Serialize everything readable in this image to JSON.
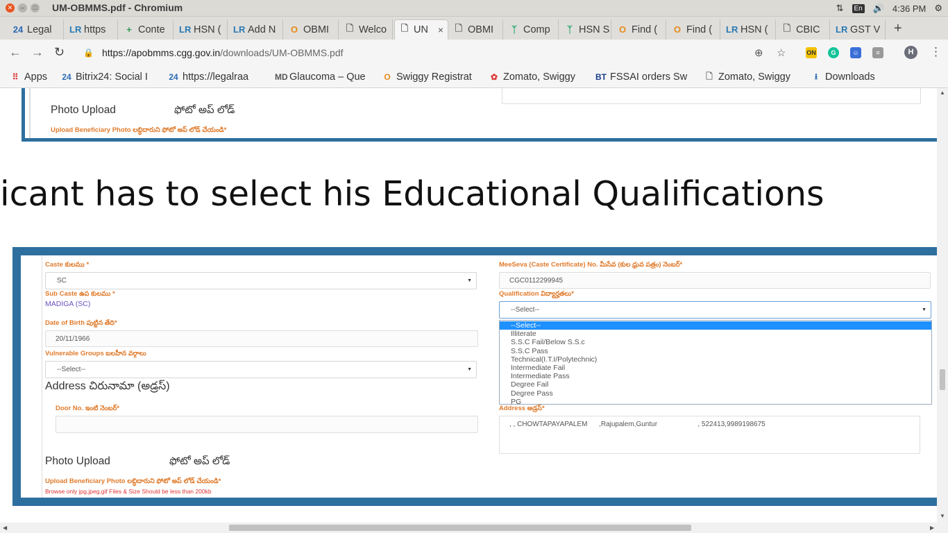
{
  "window": {
    "title": "UM-OBMMS.pdf - Chromium",
    "time": "4:36 PM",
    "keyboard_indicator": "En",
    "close_glyph": "✕",
    "min_glyph": "–",
    "max_glyph": "□"
  },
  "tabs": [
    {
      "icon_text": "24",
      "label": "Legal",
      "icon_color": "#2a6ab3"
    },
    {
      "icon_text": "LR",
      "label": "https",
      "icon_color": "#2a7ab3"
    },
    {
      "icon_text": "+",
      "label": "Conte",
      "icon_color": "#2e9e50"
    },
    {
      "icon_text": "LR",
      "label": "HSN (",
      "icon_color": "#2a7ab3"
    },
    {
      "icon_text": "LR",
      "label": "Add N",
      "icon_color": "#2a7ab3"
    },
    {
      "icon_text": "O",
      "label": "OBMI",
      "icon_color": "#e88a1a"
    },
    {
      "icon_text": "🗋",
      "label": "Welco",
      "icon_color": "#666"
    },
    {
      "icon_text": "🗋",
      "label": "UN",
      "icon_color": "#666"
    },
    {
      "icon_text": "🗋",
      "label": "OBMI",
      "icon_color": "#666"
    },
    {
      "icon_text": "ᛉ",
      "label": "Comp",
      "icon_color": "#2aa86a"
    },
    {
      "icon_text": "ᛉ",
      "label": "HSN S",
      "icon_color": "#2aa86a"
    },
    {
      "icon_text": "O",
      "label": "Find (",
      "icon_color": "#e88a1a"
    },
    {
      "icon_text": "O",
      "label": "Find (",
      "icon_color": "#e88a1a"
    },
    {
      "icon_text": "LR",
      "label": "HSN (",
      "icon_color": "#2a7ab3"
    },
    {
      "icon_text": "🗋",
      "label": "CBIC",
      "icon_color": "#666"
    },
    {
      "icon_text": "LR",
      "label": "GST V",
      "icon_color": "#2a7ab3"
    }
  ],
  "new_tab_label": "+",
  "toolbar": {
    "back": "←",
    "forward": "→",
    "reload": "↻",
    "url_host": "https://apobmms.cgg.gov.in",
    "url_path": "/downloads/UM-OBMMS.pdf",
    "profile_initial": "H",
    "menu": "⋮"
  },
  "bookmarks": [
    {
      "icon_text": "⠿",
      "label": "Apps",
      "icon_color": "#d33"
    },
    {
      "icon_text": "24",
      "label": "Bitrix24: Social I",
      "icon_color": "#2a6ab3"
    },
    {
      "icon_text": "24",
      "label": "https://legalraa",
      "icon_color": "#2a6ab3"
    },
    {
      "icon_text": "MD",
      "label": "Glaucoma – Que",
      "icon_color": "#555"
    },
    {
      "icon_text": "O",
      "label": "Swiggy Registrat",
      "icon_color": "#e88a1a"
    },
    {
      "icon_text": "✿",
      "label": "Zomato, Swiggy",
      "icon_color": "#d33"
    },
    {
      "icon_text": "BT",
      "label": "FSSAI orders Sw",
      "icon_color": "#1a3c8a"
    },
    {
      "icon_text": "🗋",
      "label": "Zomato, Swiggy",
      "icon_color": "#666"
    },
    {
      "icon_text": "⭳",
      "label": "Downloads",
      "icon_color": "#2a6ab3"
    }
  ],
  "top_panel": {
    "photo_upload": "Photo Upload",
    "photo_upload_telugu": "ఫోటో అప్ లోడ్",
    "upload_note": "Upload Beneficiary Photo లబ్ధిదారుని ఫోటో అప్ లోడ్ చేయండి*"
  },
  "heading": "icant has to select his Educational Qualifications",
  "form": {
    "caste_label": "Caste కులము *",
    "caste_value": "SC",
    "subcaste_label": "Sub Caste ఉప కులము *",
    "subcaste_value": "MADIGA (SC)",
    "dob_label": "Date of Birth పుట్టిన తేది*",
    "dob_value": "20/11/1966",
    "vulnerable_label": "Vulnerable Groups బలహీన వర్గాలు",
    "vulnerable_value": "--Select--",
    "address_heading": "Address చిరునామా (అడ్రస్)",
    "door_label": "Door No. ఇంటి నెంబర్*",
    "meeseva_label": "MeeSeva (Caste Certificate) No. మీసేవ (కుల ధ్రువ పత్రం) నెంబర్*",
    "meeseva_value": "CGC0112299945",
    "qualification_label": "Qualification విద్యార్హతలు*",
    "qualification_value": "--Select--",
    "qualification_options": [
      "--Select--",
      "Illiterate",
      "S.S.C Fail/Below S.S.c",
      "S.S.C Pass",
      "Technical(I.T.I/Polytechnic)",
      "Intermediate Fail",
      "Intermediate Pass",
      "Degree Fail",
      "Degree Pass",
      "PG"
    ],
    "address_label": "Address అడ్రస్*",
    "address_value": ", , CHOWTAPAYAPALEM      ,Rajupalem,Guntur                     , 522413,9989198675",
    "photo_upload": "Photo Upload",
    "photo_upload_telugu": "ఫోటో అప్ లోడ్",
    "upload_note": "Upload Beneficiary Photo లబ్ధిదారుని ఫోటో అప్ లోడ్ చేయండి*",
    "browse_note": "Browse only jpg,jpeg,gif Files & Size Should be less than 200kb"
  },
  "colors": {
    "panel_border": "#2d6f9e",
    "label_orange": "#e07b2c",
    "selected_option": "#1e90ff"
  }
}
